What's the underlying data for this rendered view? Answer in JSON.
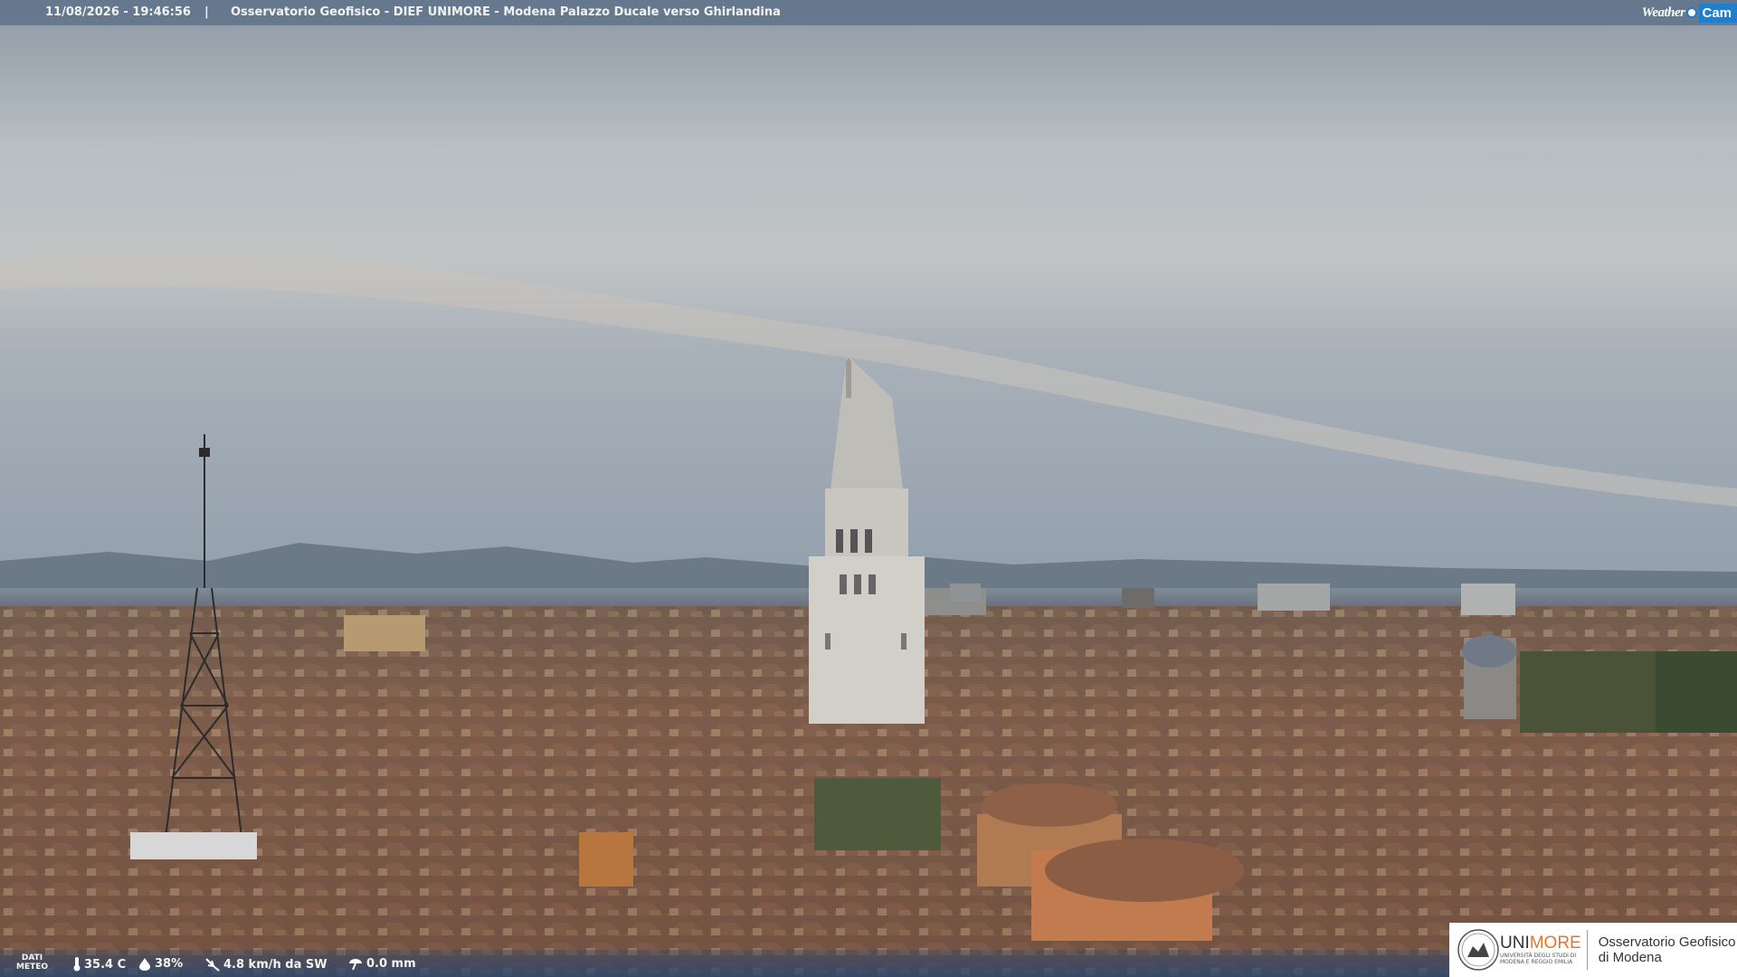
{
  "overlay": {
    "timestamp": "11/08/2026 - 19:46:56",
    "separator": "|",
    "title": "Osservatorio Geofisico - DIEF UNIMORE - Modena Palazzo Ducale verso Ghirlandina",
    "logo_weather": "Weather",
    "logo_cam": "Cam"
  },
  "meteo": {
    "label_line1": "DATI",
    "label_line2": "METEO",
    "temperature": "35.4 C",
    "humidity": "38%",
    "wind": "4.8 km/h da SW",
    "rain": "0.0 mm",
    "icons": [
      "thermometer-icon",
      "humidity-drop-icon",
      "wind-icon",
      "rain-gauge-icon"
    ]
  },
  "branding": {
    "uni_prefix": "UNI",
    "uni_suffix": "MORE",
    "uni_sub_line1": "UNIVERSITÀ DEGLI STUDI DI",
    "uni_sub_line2": "MODENA E REGGIO EMILIA",
    "obs_line1": "Osservatorio Geofisico",
    "obs_line2": "di Modena"
  },
  "colors": {
    "accent_blue": "#1e7fd0",
    "unimore_orange": "#e0772a"
  }
}
